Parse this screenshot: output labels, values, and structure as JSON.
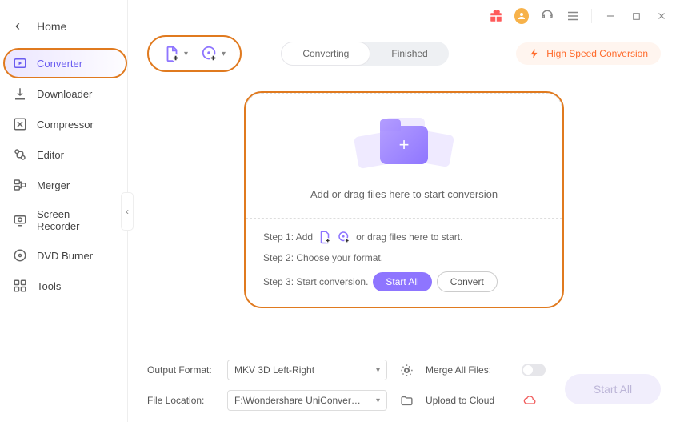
{
  "home": {
    "label": "Home"
  },
  "sidebar": {
    "items": [
      {
        "label": "Converter"
      },
      {
        "label": "Downloader"
      },
      {
        "label": "Compressor"
      },
      {
        "label": "Editor"
      },
      {
        "label": "Merger"
      },
      {
        "label": "Screen Recorder"
      },
      {
        "label": "DVD Burner"
      },
      {
        "label": "Tools"
      }
    ]
  },
  "tabs": {
    "converting": "Converting",
    "finished": "Finished"
  },
  "high_speed": "High Speed Conversion",
  "dropzone": {
    "text": "Add or drag files here to start conversion",
    "step1a": "Step 1: Add",
    "step1b": "or drag files here to start.",
    "step2": "Step 2: Choose your format.",
    "step3": "Step 3: Start conversion.",
    "start_all": "Start All",
    "convert": "Convert"
  },
  "footer": {
    "output_format_label": "Output Format:",
    "output_format_value": "MKV 3D Left-Right",
    "merge_label": "Merge All Files:",
    "file_location_label": "File Location:",
    "file_location_value": "F:\\Wondershare UniConverter 1",
    "cloud_label": "Upload to Cloud",
    "start_all": "Start All"
  }
}
